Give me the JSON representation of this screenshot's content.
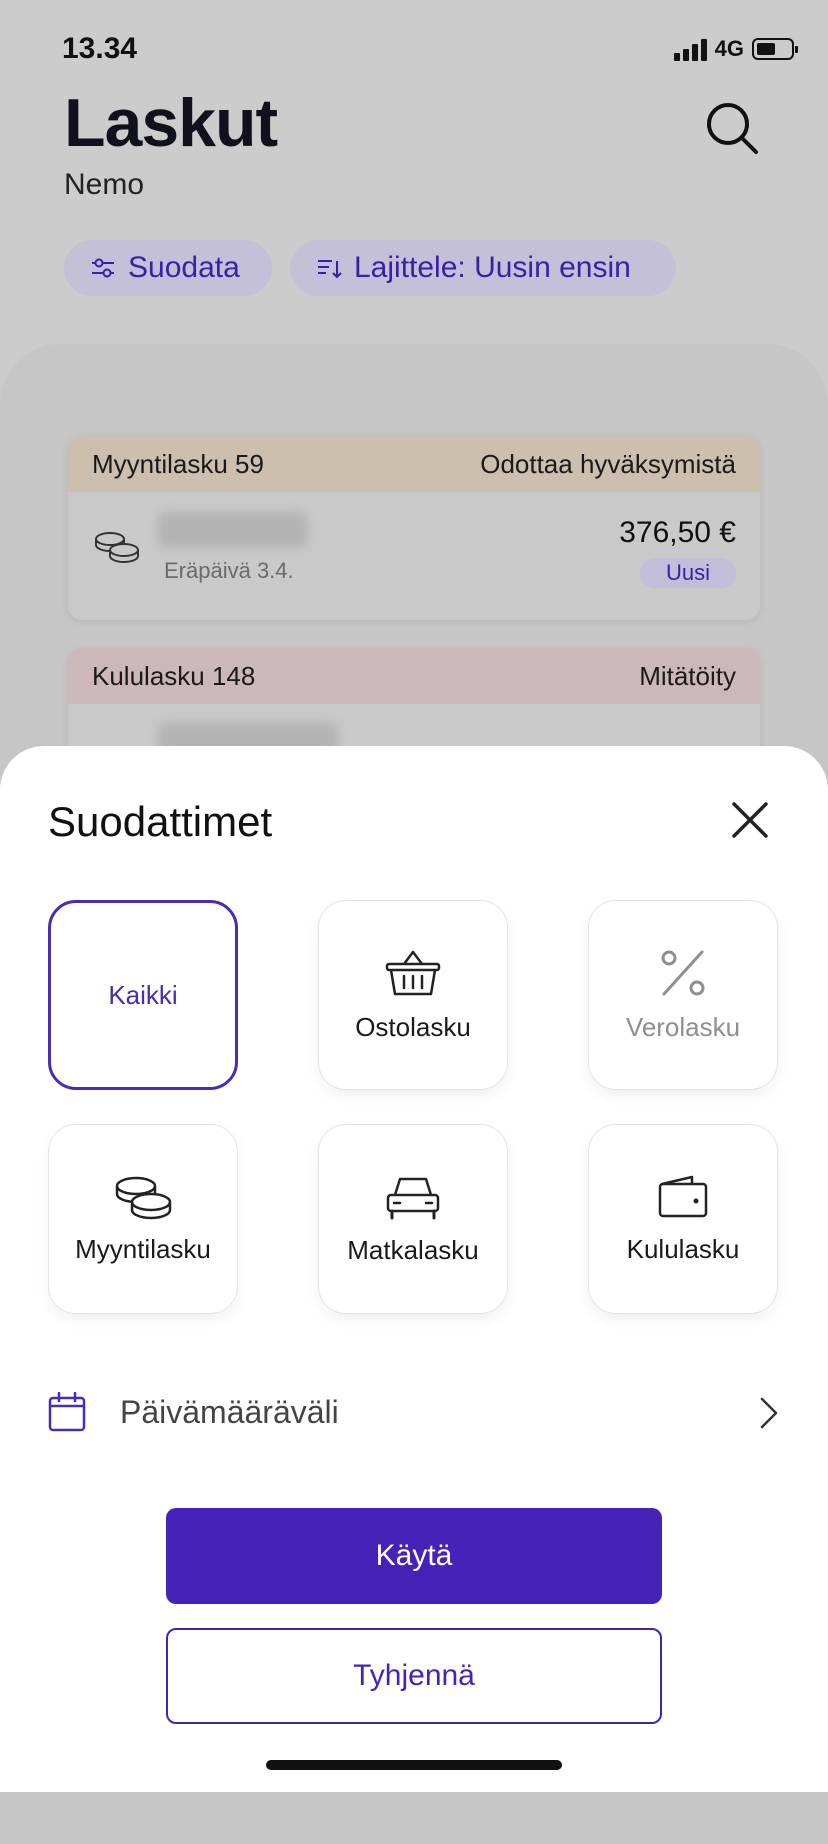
{
  "status_bar": {
    "time": "13.34",
    "network": "4G"
  },
  "header": {
    "title": "Laskut",
    "company": "Nemo"
  },
  "chips": {
    "filter_label": "Suodata",
    "sort_label": "Lajittele: Uusin ensin"
  },
  "invoices": [
    {
      "type_label": "Myyntilasku 59",
      "status": "Odottaa hyväksymistä",
      "due_date": "Eräpäivä 3.4.",
      "amount": "376,50 €",
      "badge": "Uusi"
    },
    {
      "type_label": "Kululasku 148",
      "status": "Mitätöity"
    }
  ],
  "sheet": {
    "title": "Suodattimet",
    "tiles": [
      {
        "label": "Kaikki",
        "state": "selected"
      },
      {
        "label": "Ostolasku",
        "icon": "basket-icon"
      },
      {
        "label": "Verolasku",
        "icon": "percent-icon",
        "state": "disabled"
      },
      {
        "label": "Myyntilasku",
        "icon": "coins-icon"
      },
      {
        "label": "Matkalasku",
        "icon": "car-icon"
      },
      {
        "label": "Kululasku",
        "icon": "wallet-icon"
      }
    ],
    "date_range_label": "Päivämääräväli",
    "apply_label": "Käytä",
    "clear_label": "Tyhjennä"
  },
  "colors": {
    "accent": "#4623b8",
    "chip_bg": "#c4c0d8",
    "sales_header": "#cdbfae",
    "expense_header": "#ccb8bb"
  }
}
